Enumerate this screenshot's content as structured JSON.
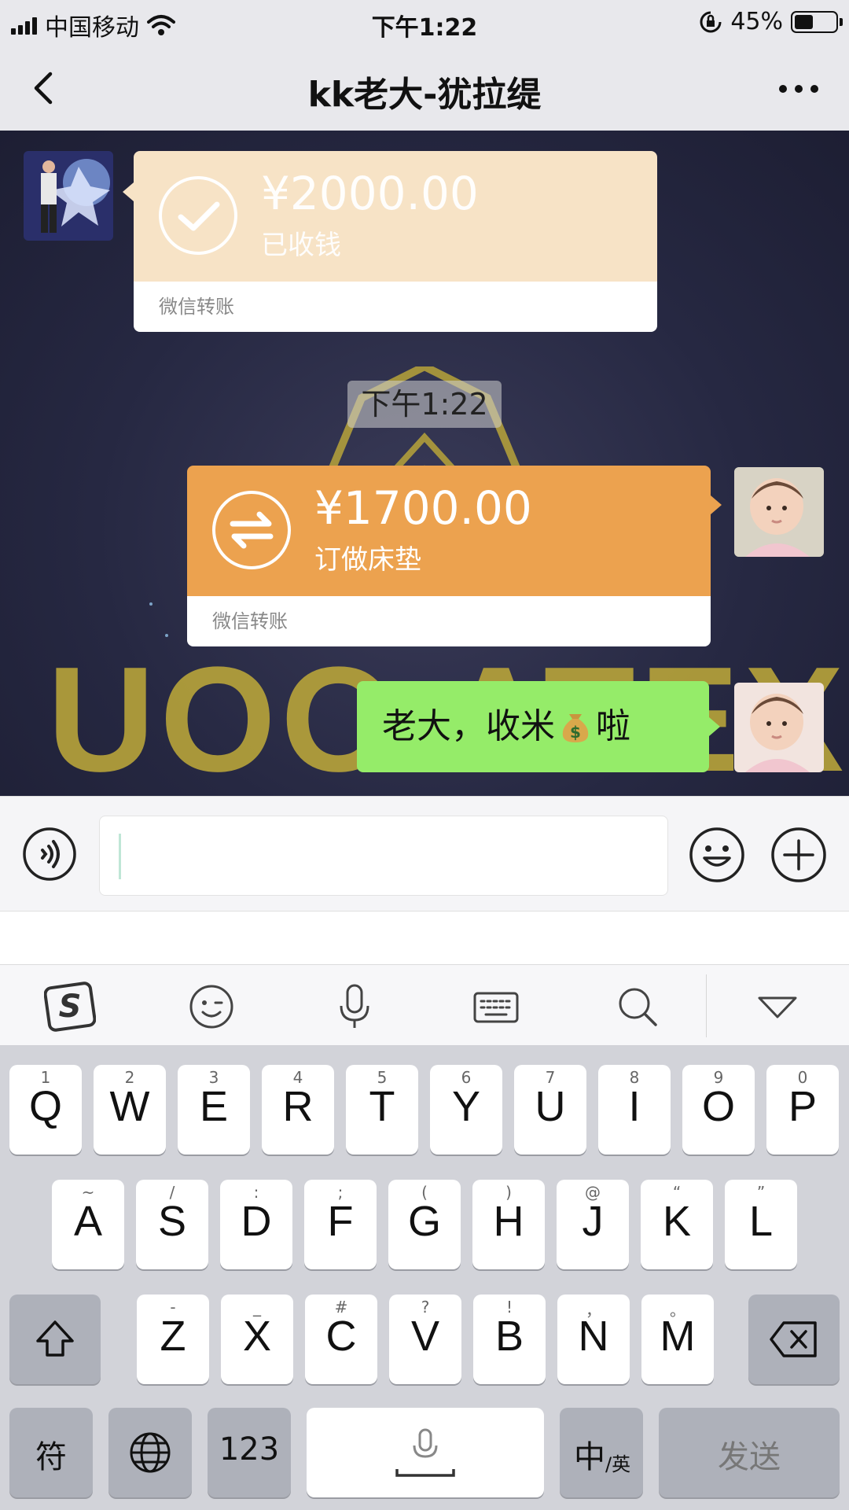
{
  "status_bar": {
    "carrier": "中国移动",
    "time": "下午1:22",
    "battery_text": "45%",
    "battery_level": 0.45
  },
  "nav": {
    "title": "kk老大-犹拉缇",
    "back_icon": "chevron-left-icon",
    "more_icon": "more-dots-icon"
  },
  "messages": {
    "received_transfer": {
      "amount": "¥2000.00",
      "status": "已收钱",
      "footer": "微信转账",
      "icon": "check-circle-icon"
    },
    "timestamp": "下午1:22",
    "sent_transfer": {
      "amount": "¥1700.00",
      "note": "订做床垫",
      "footer": "微信转账",
      "icon": "exchange-arrows-icon"
    },
    "sent_text": {
      "before_emoji": "老大，收米",
      "emoji": "money-bag-icon",
      "after_emoji": "啦"
    }
  },
  "colors": {
    "received_transfer": "#f7e3c6",
    "sent_transfer": "#eca24f",
    "text_bubble": "#95ec69"
  },
  "background": {
    "watermark_text": "UOO ATEX"
  },
  "keyboard": {
    "row1": [
      {
        "sub": "1",
        "main": "Q"
      },
      {
        "sub": "2",
        "main": "W"
      },
      {
        "sub": "3",
        "main": "E"
      },
      {
        "sub": "4",
        "main": "R"
      },
      {
        "sub": "5",
        "main": "T"
      },
      {
        "sub": "6",
        "main": "Y"
      },
      {
        "sub": "7",
        "main": "U"
      },
      {
        "sub": "8",
        "main": "I"
      },
      {
        "sub": "9",
        "main": "O"
      },
      {
        "sub": "0",
        "main": "P"
      }
    ],
    "row2": [
      {
        "sub": "~",
        "main": "A"
      },
      {
        "sub": "/",
        "main": "S"
      },
      {
        "sub": ":",
        "main": "D"
      },
      {
        "sub": ";",
        "main": "F"
      },
      {
        "sub": "(",
        "main": "G"
      },
      {
        "sub": ")",
        "main": "H"
      },
      {
        "sub": "@",
        "main": "J"
      },
      {
        "sub": "“",
        "main": "K"
      },
      {
        "sub": "”",
        "main": "L"
      }
    ],
    "row3": [
      {
        "sub": "-",
        "main": "Z"
      },
      {
        "sub": "_",
        "main": "X"
      },
      {
        "sub": "#",
        "main": "C"
      },
      {
        "sub": "?",
        "main": "V"
      },
      {
        "sub": "!",
        "main": "B"
      },
      {
        "sub": "，",
        "main": "N"
      },
      {
        "sub": "。",
        "main": "M"
      }
    ],
    "symbols_label": "符",
    "numbers_label": "123",
    "lang_main": "中",
    "lang_sub": "/英",
    "send_label": "发送"
  }
}
